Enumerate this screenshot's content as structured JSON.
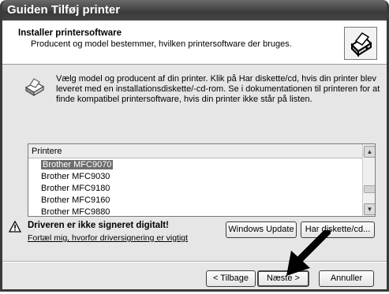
{
  "window": {
    "title": "Guiden Tilføj printer"
  },
  "header": {
    "title": "Installer printersoftware",
    "subtitle": "Producent og model bestemmer, hvilken printersoftware der bruges.",
    "icon": "printer-wizard-icon"
  },
  "info": {
    "icon": "printer-icon",
    "text": "Vælg model og producent af din printer. Klik på Har diskette/cd, hvis din printer blev leveret med en installationsdiskette/-cd-rom. Se i dokumentationen til printeren for at finde kompatibel printersoftware, hvis din printer ikke står på listen."
  },
  "printer_list": {
    "header": "Printere",
    "items": [
      "Brother MFC9070",
      "Brother MFC9030",
      "Brother MFC9180",
      "Brother MFC9160",
      "Brother MFC9880"
    ],
    "selected": "Brother MFC9070"
  },
  "signature": {
    "icon": "warning-icon",
    "warning": "Driveren er ikke signeret digitalt!",
    "link": "Fortæl mig, hvorfor driversignering er vigtigt"
  },
  "buttons": {
    "windows_update": "Windows Update",
    "have_disk": "Har diskette/cd...",
    "back": "< Tilbage",
    "next": "Næste >",
    "cancel": "Annuller"
  },
  "colors": {
    "selection": "#6d6d6d",
    "titlebar": "#3a3a3a"
  }
}
